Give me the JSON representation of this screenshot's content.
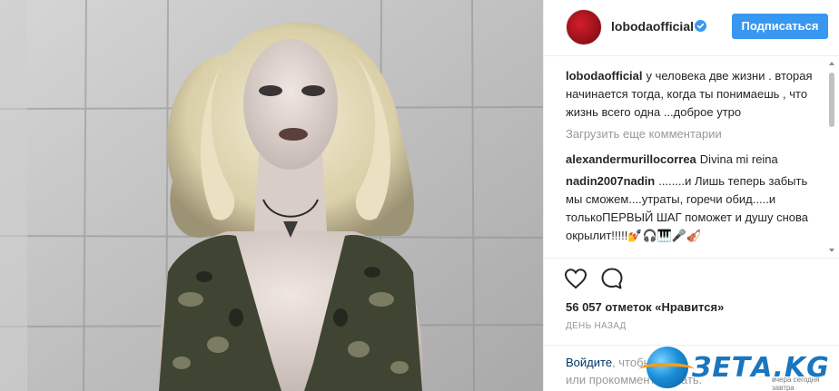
{
  "post": {
    "username": "lobodaofficial",
    "verified": true,
    "follow_label": "Подписаться",
    "caption_author": "lobodaofficial",
    "caption_text": "у человека две жизни . вторая начинается тогда, когда ты понимаешь , что жизнь всего одна ...доброе утро",
    "load_more_label": "Загрузить еще комментарии",
    "comments": [
      {
        "author": "alexandermurillocorrea",
        "text": "Divina mi reina"
      },
      {
        "author": "nadin2007nadin",
        "text": "........и Лишь теперь забыть мы сможем....утраты, горечи обид.....и толькоПЕРВЫЙ ШАГ поможет и душу снова окрылит!!!!!💅🎧🎹🎤🎻"
      }
    ],
    "likes_text": "56 057 отметок «Нравится»",
    "timestamp": "ДЕНЬ НАЗАД",
    "login_link": "Войдите",
    "login_text_1": ", чтобы",
    "login_text_2": "или прокомментировать."
  },
  "watermark": {
    "text": "ЗЕТА.KG",
    "tagline": "вчера сегодня завтра"
  },
  "colors": {
    "accent": "#3897f0",
    "link": "#003569",
    "muted": "#999999",
    "text": "#262626"
  },
  "icons": {
    "like": "heart-outline-icon",
    "comment": "speech-bubble-icon",
    "verified": "verified-badge-icon"
  }
}
